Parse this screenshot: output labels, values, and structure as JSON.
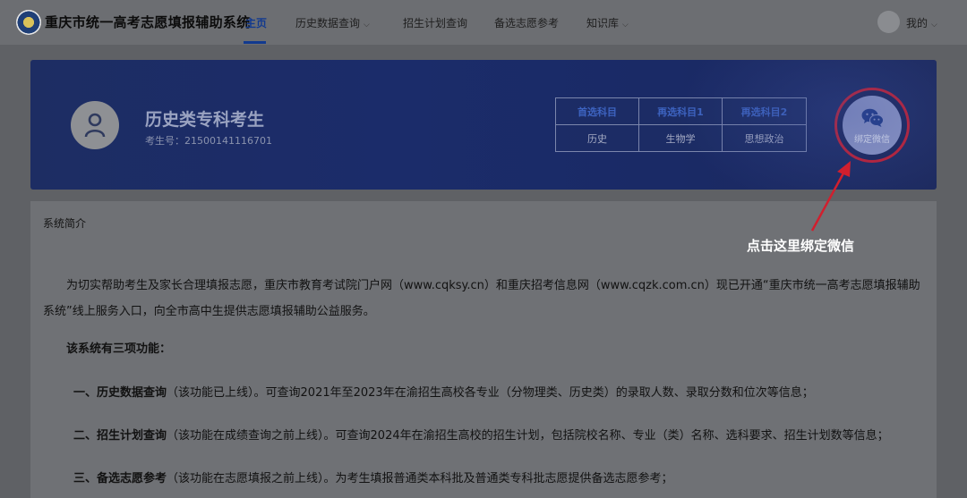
{
  "header": {
    "site_title": "重庆市统一高考志愿填报辅助系统",
    "nav": [
      {
        "label": "主页",
        "active": true,
        "has_caret": false
      },
      {
        "label": "历史数据查询",
        "active": false,
        "has_caret": true
      },
      {
        "label": "招生计划查询",
        "active": false,
        "has_caret": false
      },
      {
        "label": "备选志愿参考",
        "active": false,
        "has_caret": false
      },
      {
        "label": "知识库",
        "active": false,
        "has_caret": true
      }
    ],
    "user_menu_label": "我的",
    "caret_glyph": "⌵",
    "icons": [
      "logo-icon",
      "avatar-icon",
      "chevron-down-icon"
    ]
  },
  "banner": {
    "candidate_type": "历史类专科考生",
    "candidate_id_label": "考生号：",
    "candidate_id": "21500141116701",
    "subjects": {
      "headers": [
        "首选科目",
        "再选科目1",
        "再选科目2"
      ],
      "values": [
        "历史",
        "生物学",
        "思想政治"
      ]
    },
    "wechat_button_label": "绑定微信",
    "colors": {
      "accent": "#123a8f",
      "highlight_ring": "#c81e2e",
      "banner_bg": "#1b2c6a"
    }
  },
  "annotation": {
    "text": "点击这里绑定微信"
  },
  "intro": {
    "section_title": "系统简介",
    "paragraph": "为切实帮助考生及家长合理填报志愿，重庆市教育考试院门户网（www.cqksy.cn）和重庆招考信息网（www.cqzk.com.cn）现已开通“重庆市统一高考志愿填报辅助系统”线上服务入口，向全市高中生提供志愿填报辅助公益服务。",
    "functions_heading": "该系统有三项功能：",
    "functions": [
      {
        "title": "一、历史数据查询",
        "status": "（该功能已上线）",
        "desc": "。可查询2021年至2023年在渝招生高校各专业（分物理类、历史类）的录取人数、录取分数和位次等信息；"
      },
      {
        "title": "二、招生计划查询",
        "status": "（该功能在成绩查询之前上线）",
        "desc": "。可查询2024年在渝招生高校的招生计划，包括院校名称、专业（类）名称、选科要求、招生计划数等信息；"
      },
      {
        "title": "三、备选志愿参考",
        "status": "（该功能在志愿填报之前上线）",
        "desc": "。为考生填报普通类本科批及普通类专科批志愿提供备选志愿参考；"
      }
    ]
  }
}
